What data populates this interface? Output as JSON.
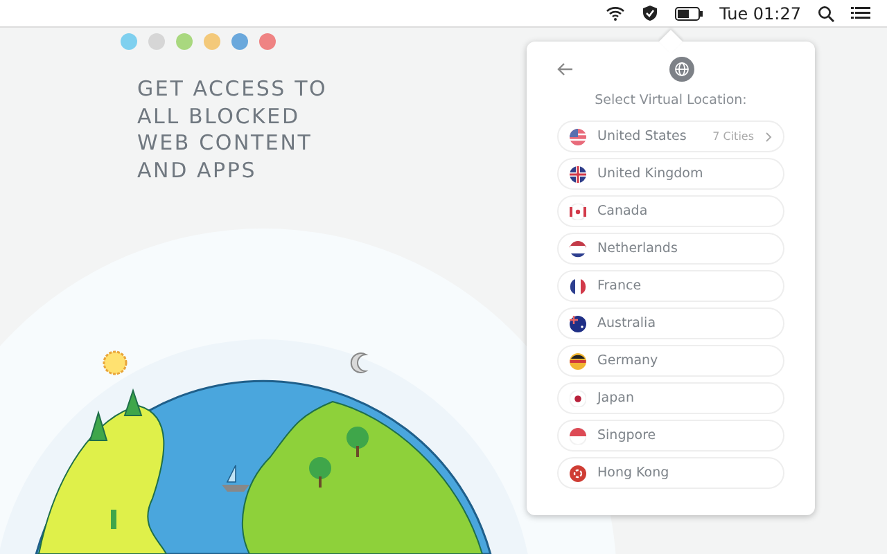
{
  "menu_bar": {
    "clock": "Tue 01:27"
  },
  "dots": [
    {
      "color": "#7fd0ef"
    },
    {
      "color": "#d6d6d6"
    },
    {
      "color": "#a9d87f"
    },
    {
      "color": "#f3c97a"
    },
    {
      "color": "#6aa8dc"
    },
    {
      "color": "#ef8383"
    }
  ],
  "headline": [
    "GET ACCESS TO",
    "ALL BLOCKED",
    "WEB CONTENT",
    "AND APPS"
  ],
  "popup": {
    "title": "Select Virtual Location:",
    "locations": [
      {
        "name": "United States",
        "kind": "us",
        "cities": "7 Cities"
      },
      {
        "name": "United Kingdom",
        "kind": "uk"
      },
      {
        "name": "Canada",
        "kind": "ca"
      },
      {
        "name": "Netherlands",
        "kind": "nl"
      },
      {
        "name": "France",
        "kind": "fr"
      },
      {
        "name": "Australia",
        "kind": "au"
      },
      {
        "name": "Germany",
        "kind": "de"
      },
      {
        "name": "Japan",
        "kind": "jp"
      },
      {
        "name": "Singpore",
        "kind": "sg"
      },
      {
        "name": "Hong Kong",
        "kind": "hk"
      }
    ]
  }
}
